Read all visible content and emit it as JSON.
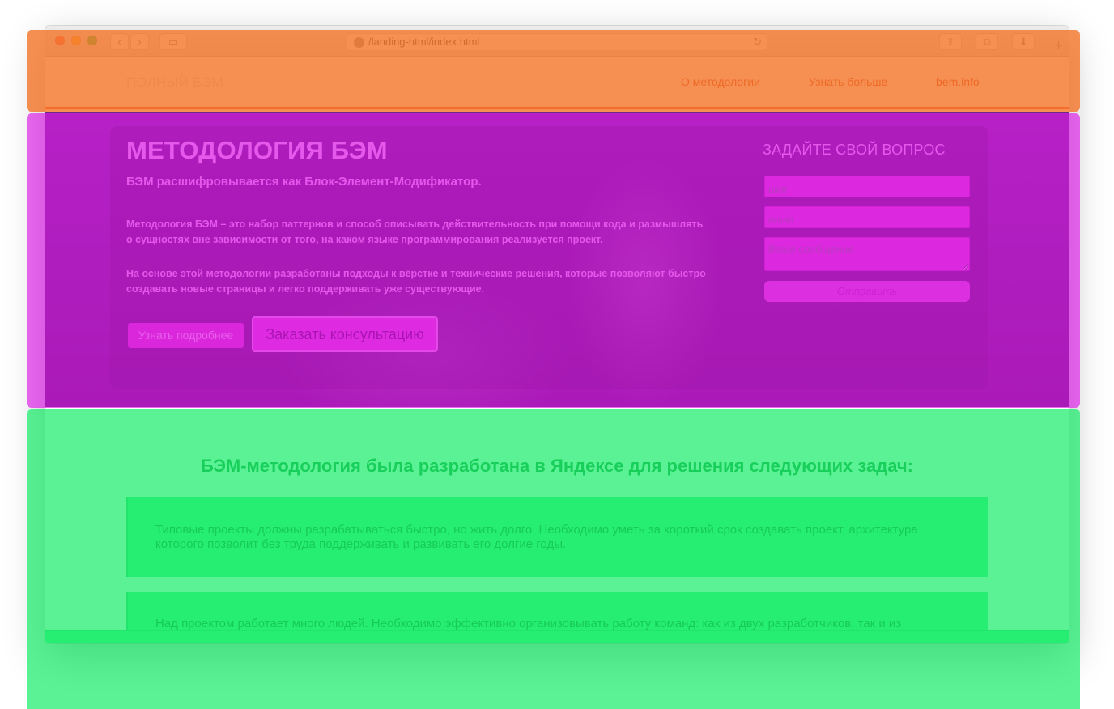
{
  "browser": {
    "url": "/landing-html/index.html",
    "back_icon": "chevron-left-icon",
    "forward_icon": "chevron-right-icon",
    "new_tab_label": "+"
  },
  "nav": {
    "brand": "ПОЛНЫЙ БЭМ",
    "links": [
      "О методологии",
      "Узнать больше",
      "bem.info"
    ]
  },
  "hero": {
    "title": "МЕТОДОЛОГИЯ БЭМ",
    "subtitle": "БЭМ расшифровывается как Блок-Элемент-Модификатор.",
    "paragraph1": "Методология БЭМ – это набор паттернов и способ описывать действительность при помощи кода и размышлять о сущностях вне зависимости от того, на каком языке программирования реализуется проект.",
    "paragraph2": "На основе этой методологии разработаны подходы к вёрстке и технические решения, которые позволяют быстро создавать новые страницы и легко поддерживать уже существующие.",
    "button_more": "Узнать подробнее",
    "button_consult": "Заказать консультацию"
  },
  "form": {
    "title": "ЗАДАЙТЕ СВОЙ ВОПРОС",
    "name_placeholder": "имя",
    "email_placeholder": "email",
    "message_placeholder": "Ваше сообщение",
    "submit": "Отправить"
  },
  "content": {
    "title": "БЭМ-методология была разработана в Яндексе для решения следующих задач:",
    "tasks": [
      "Типовые проекты должны разрабатываться быстро, но жить долго. Необходимо уметь за короткий срок создавать проект, архитектура которого позволит без труда поддерживать и развивать его долгие годы.",
      "Над проектом работает много людей. Необходимо эффективно организовывать работу команд: как из двух разработчиков, так и из"
    ]
  },
  "colors": {
    "overlay_nav": "#f4762c",
    "overlay_hero": "#dc1ce6",
    "overlay_content": "#14ed66"
  }
}
